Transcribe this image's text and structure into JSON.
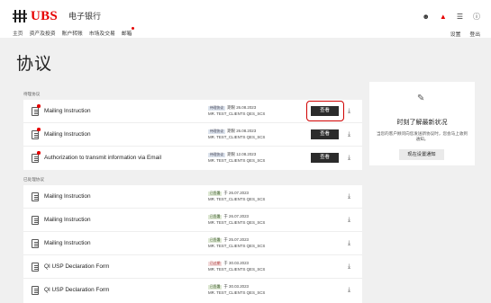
{
  "header": {
    "brand": "UBS",
    "brand_sub": "电子银行",
    "nav": [
      "主页",
      "资产及投资",
      "账户转账",
      "市场及交易",
      "邮箱"
    ],
    "right_links": [
      "设置",
      "登出"
    ],
    "icons": [
      "user-icon",
      "bell-icon",
      "menu-icon",
      "help-icon"
    ]
  },
  "page_title": "协议",
  "sections": {
    "pending_label": "待理协议",
    "done_label": "已处理协议"
  },
  "pending": [
    {
      "title": "Mailing Instruction",
      "status": "待理协议",
      "date_text": "期限 26.08.2023",
      "client": "MR. TEST_CLIENTS QES_SCS",
      "button": "查看"
    },
    {
      "title": "Mailing Instruction",
      "status": "待理协议",
      "date_text": "期限 26.08.2023",
      "client": "MR. TEST_CLIENTS QES_SCS",
      "button": "查看"
    },
    {
      "title": "Authorization to transmit information via Email",
      "status": "待理协议",
      "date_text": "期限 12.08.2023",
      "client": "MR. TEST_CLIENTS QES_SCS",
      "button": "查看"
    }
  ],
  "done": [
    {
      "title": "Mailing Instruction",
      "status": "已签署",
      "date_text": "于 26.07.2023",
      "client": "MR. TEST_CLIENTS QES_SCS",
      "kind": "done"
    },
    {
      "title": "Mailing Instruction",
      "status": "已签署",
      "date_text": "于 26.07.2023",
      "client": "MR. TEST_CLIENTS QES_SCS",
      "kind": "done"
    },
    {
      "title": "Mailing Instruction",
      "status": "已签署",
      "date_text": "于 25.07.2023",
      "client": "MR. TEST_CLIENTS QES_SCS",
      "kind": "done"
    },
    {
      "title": "QI USP Declaration Form",
      "status": "已过期",
      "date_text": "于 30.03.2023",
      "client": "MR. TEST_CLIENTS QES_SCS",
      "kind": "expired"
    },
    {
      "title": "QI USP Declaration Form",
      "status": "已签署",
      "date_text": "于 30.03.2023",
      "client": "MR. TEST_CLIENTS QES_SCS",
      "kind": "done"
    }
  ],
  "side": {
    "heading": "时刻了解最新状况",
    "text": "当您的客户顾问向您发送新协议时，您会马上收到通知。",
    "button": "现在设置通知"
  },
  "colors": {
    "brand_red": "#e60000",
    "dark_button": "#2b2b2b",
    "background": "#f0f0f0"
  }
}
